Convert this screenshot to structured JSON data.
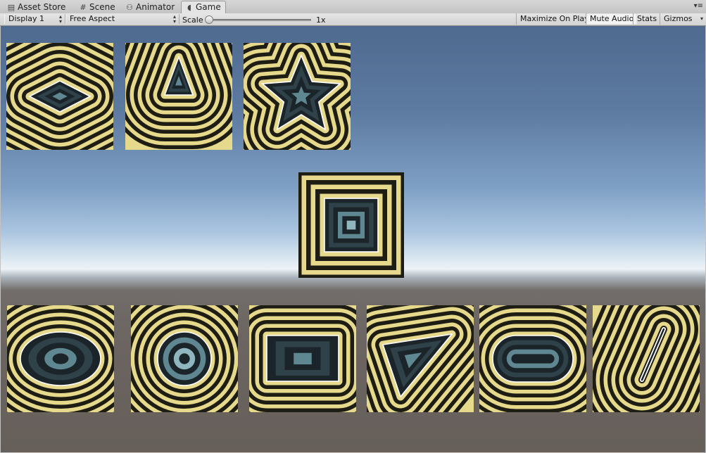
{
  "tabs": [
    {
      "label": "Asset Store",
      "icon": "asset-store-icon"
    },
    {
      "label": "Scene",
      "icon": "scene-grid-icon"
    },
    {
      "label": "Animator",
      "icon": "animator-icon"
    },
    {
      "label": "Game",
      "icon": "game-pacman-icon",
      "active": true
    }
  ],
  "toolbar": {
    "display": "Display 1",
    "aspect": "Free Aspect",
    "scale_label": "Scale",
    "scale_value": "1x",
    "scale_fraction": 0.0,
    "maximize_on_play": "Maximize On Play",
    "mute_audio": "Mute Audio",
    "stats": "Stats",
    "gizmos": "Gizmos"
  },
  "colors": {
    "band_light": "#e6d98c",
    "band_dark": "#1e1d14",
    "inside_dark": "#1b2428",
    "inside_light": "#8fb5bf",
    "outline": "#ffffff"
  },
  "shapes": [
    {
      "name": "rhombus"
    },
    {
      "name": "triangle"
    },
    {
      "name": "star"
    },
    {
      "name": "square"
    },
    {
      "name": "ellipse"
    },
    {
      "name": "circle"
    },
    {
      "name": "rectangle"
    },
    {
      "name": "triangle-tilted"
    },
    {
      "name": "capsule"
    },
    {
      "name": "line-segment"
    }
  ]
}
